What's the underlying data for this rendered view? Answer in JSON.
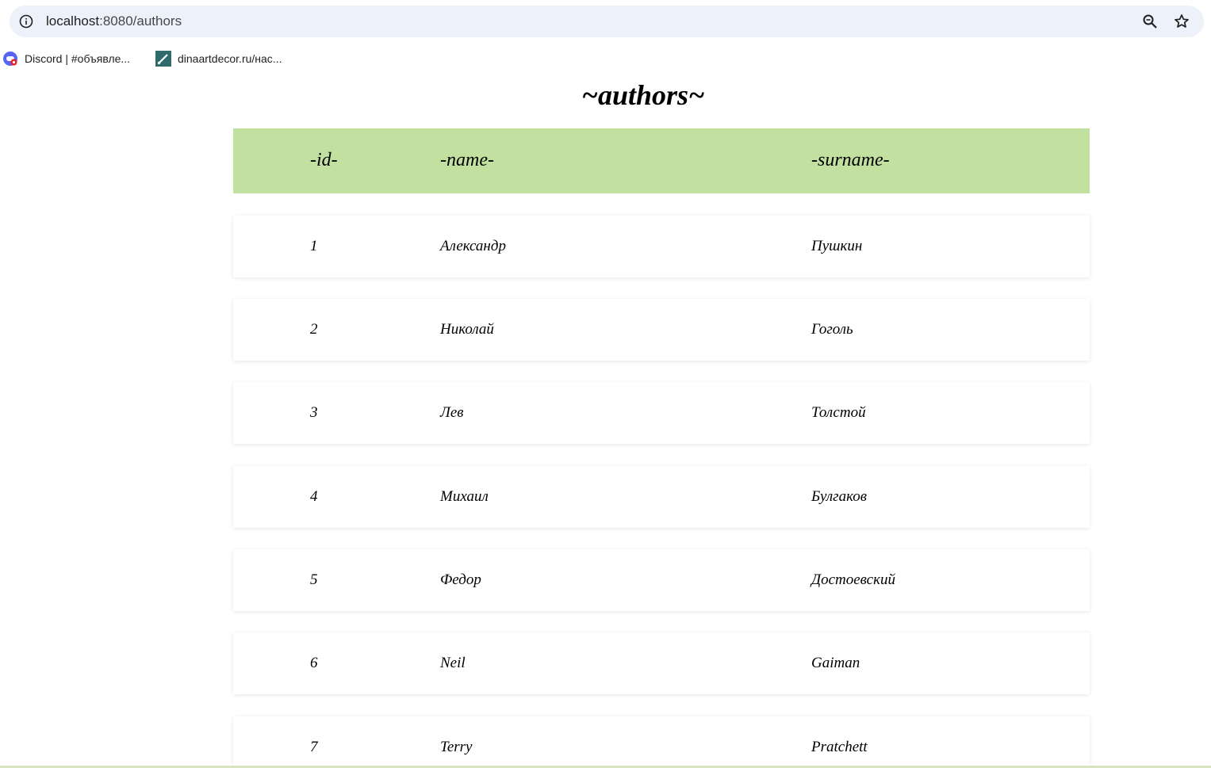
{
  "browser": {
    "url_host": "localhost",
    "url_path": ":8080/authors",
    "icons": {
      "info": "info-icon",
      "zoom": "zoom-icon",
      "bookmark_star": "star-icon"
    }
  },
  "bookmarks": [
    {
      "label": "Discord | #объявле...",
      "icon": "discord-icon"
    },
    {
      "label": "dinaartdecor.ru/нас...",
      "icon": "brush-icon"
    }
  ],
  "page": {
    "title": "~authors~"
  },
  "table": {
    "headers": {
      "id": "-id-",
      "name": "-name-",
      "surname": "-surname-"
    },
    "rows": [
      {
        "id": "1",
        "name": "Александр",
        "surname": "Пушкин"
      },
      {
        "id": "2",
        "name": "Николай",
        "surname": "Гоголь"
      },
      {
        "id": "3",
        "name": "Лев",
        "surname": "Толстой"
      },
      {
        "id": "4",
        "name": "Михаил",
        "surname": "Булгаков"
      },
      {
        "id": "5",
        "name": "Федор",
        "surname": "Достоевский"
      },
      {
        "id": "6",
        "name": "Neil",
        "surname": "Gaiman"
      },
      {
        "id": "7",
        "name": "Terry",
        "surname": "Pratchett"
      }
    ]
  },
  "colors": {
    "header_bg": "#c2e0a0",
    "addressbar_bg": "#edf1f9"
  }
}
